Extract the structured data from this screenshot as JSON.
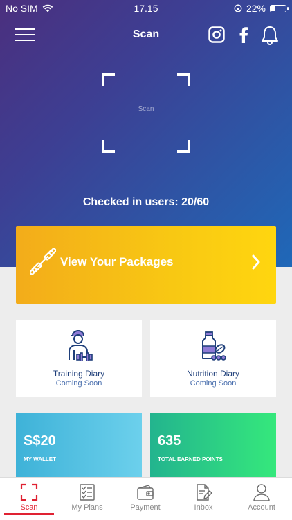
{
  "status_bar": {
    "carrier": "No SIM",
    "time": "17.15",
    "battery": "22%"
  },
  "nav": {
    "title": "Scan",
    "icons": [
      "menu-icon",
      "instagram-icon",
      "facebook-icon",
      "bell-icon"
    ]
  },
  "scanner": {
    "label": "Scan"
  },
  "checkin": {
    "text": "Checked in users: 20/60"
  },
  "packages": {
    "label": "View Your Packages"
  },
  "cards": [
    {
      "title": "Training Diary",
      "subtitle": "Coming Soon"
    },
    {
      "title": "Nutrition Diary",
      "subtitle": "Coming Soon"
    }
  ],
  "stats": {
    "wallet": {
      "value": "S$20",
      "caption": "MY WALLET"
    },
    "points": {
      "value": "635",
      "caption": "TOTAL EARNED POINTS"
    }
  },
  "tabs": [
    {
      "label": "Scan",
      "active": true
    },
    {
      "label": "My Plans"
    },
    {
      "label": "Payment"
    },
    {
      "label": "Inbox"
    },
    {
      "label": "Account"
    }
  ],
  "colors": {
    "accent_red": "#e02233",
    "dark_blue_text": "#1f3f7a",
    "banner_yellow": "#f8c813"
  }
}
